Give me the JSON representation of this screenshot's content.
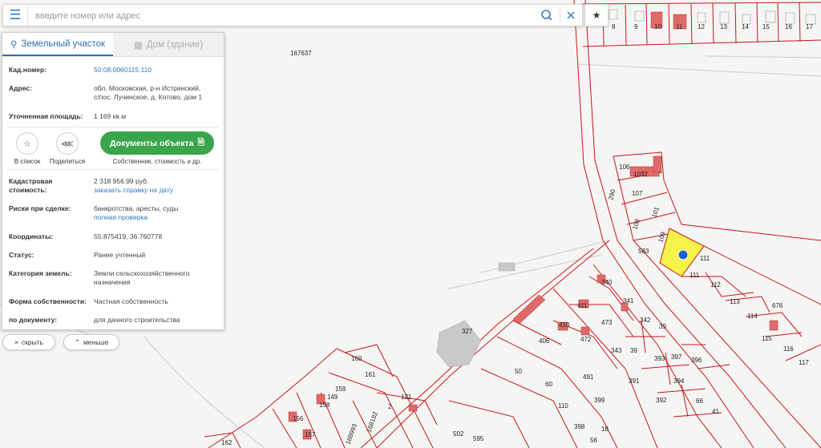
{
  "search": {
    "placeholder": "введите номер или адрес"
  },
  "icons": {
    "menu": "menu-icon",
    "search": "search-icon",
    "clear": "close-icon",
    "favorite": "star-icon"
  },
  "colors": {
    "parcel_border": "#c8151b",
    "building": "#e06a6a",
    "selected_parcel": "#f5f24a",
    "accent": "#2c6fb3",
    "docs_button": "#3aa54a",
    "marker": "#1f5fd1"
  },
  "tabs": [
    {
      "label": "Земельный участок",
      "icon": "location-pin-icon"
    },
    {
      "label": "Дом (здание)",
      "icon": "building-icon"
    }
  ],
  "info": {
    "cad_number": {
      "label": "Кад.номер:",
      "value": "50:08:0060115:110"
    },
    "address": {
      "label": "Адрес:",
      "value_line1": "обл. Московская, р-н Истринский,",
      "value_line2": "с/пос. Лучинское, д. Котово, дом 1"
    },
    "area": {
      "label": "Уточненная площадь:",
      "value": "1 169 кв.м"
    }
  },
  "actions": {
    "save": {
      "label": "В список",
      "icon": "star-outline-icon"
    },
    "share": {
      "label": "Поделиться",
      "icon": "share-icon"
    },
    "docs": {
      "label": "Документы объекта",
      "icon": "document-icon",
      "sublabel": "Собственник, стоимость и др."
    }
  },
  "details": {
    "cost": {
      "label_line1": "Кадастровая",
      "label_line2": "стоимость:",
      "value": "2 318 956.99 руб.",
      "link": "заказать справку на дату"
    },
    "risks": {
      "label": "Риски при сделке:",
      "value": "банкротства, аресты, суды",
      "link": "полная проверка"
    },
    "coords": {
      "label": "Координаты:",
      "value": "55.875419, 36.760778"
    },
    "status": {
      "label": "Статус:",
      "value": "Ранее учтенный"
    },
    "category": {
      "label": "Категория земель:",
      "value_line1": "Земли сельскохозяйственного",
      "value_line2": "назначения"
    },
    "ownership": {
      "label": "Форма собственности:",
      "value": "Частная собственность"
    },
    "by_document": {
      "label": "по документу:",
      "value": "для дачного строительства"
    }
  },
  "controls": {
    "hide": "скрыть",
    "less": "меньше"
  },
  "map_labels": {
    "top_row": [
      "8",
      "9",
      "10",
      "11",
      "12",
      "13",
      "14",
      "15",
      "16",
      "17"
    ],
    "block": "167637",
    "parcels_right": [
      "106",
      "106",
      "1032",
      "107",
      "108",
      "109",
      "110",
      "111",
      "111",
      "112",
      "113",
      "114",
      "115",
      "116",
      "117",
      "290",
      "583",
      "101",
      "676"
    ],
    "parcels_center": [
      "340",
      "341",
      "411",
      "410",
      "472",
      "473",
      "342",
      "39",
      "343",
      "39",
      "393",
      "397",
      "396",
      "391",
      "392",
      "394",
      "66",
      "41",
      "327",
      "406",
      "491",
      "50",
      "60",
      "110",
      "399",
      "18",
      "398",
      "502",
      "595",
      "56"
    ],
    "parcels_left": [
      "160",
      "161",
      "159",
      "149",
      "158",
      "156",
      "157",
      "121",
      "2",
      "168192",
      "168993",
      "162"
    ]
  }
}
